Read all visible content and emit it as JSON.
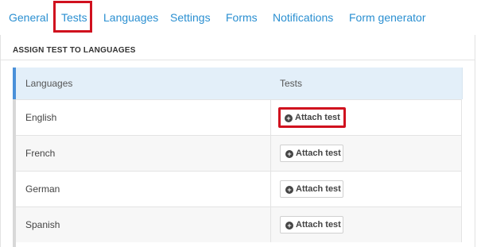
{
  "tabs": {
    "items": [
      {
        "label": "General"
      },
      {
        "label": "Tests"
      },
      {
        "label": "Languages"
      },
      {
        "label": "Settings"
      },
      {
        "label": "Forms"
      },
      {
        "label": "Notifications"
      },
      {
        "label": "Form generator"
      }
    ],
    "active": "Tests"
  },
  "section": {
    "title": "ASSIGN TEST TO LANGUAGES"
  },
  "table": {
    "headers": {
      "languages": "Languages",
      "tests": "Tests"
    },
    "rows": [
      {
        "language": "English",
        "action": "Attach test"
      },
      {
        "language": "French",
        "action": "Attach test"
      },
      {
        "language": "German",
        "action": "Attach test"
      },
      {
        "language": "Spanish",
        "action": "Attach test"
      }
    ]
  },
  "colors": {
    "link": "#2a8fd1",
    "highlight": "#d0101e",
    "accent": "#4a90d9",
    "header_bg": "#e3eff9"
  },
  "icons": {
    "attach": "plus-circle-icon"
  }
}
